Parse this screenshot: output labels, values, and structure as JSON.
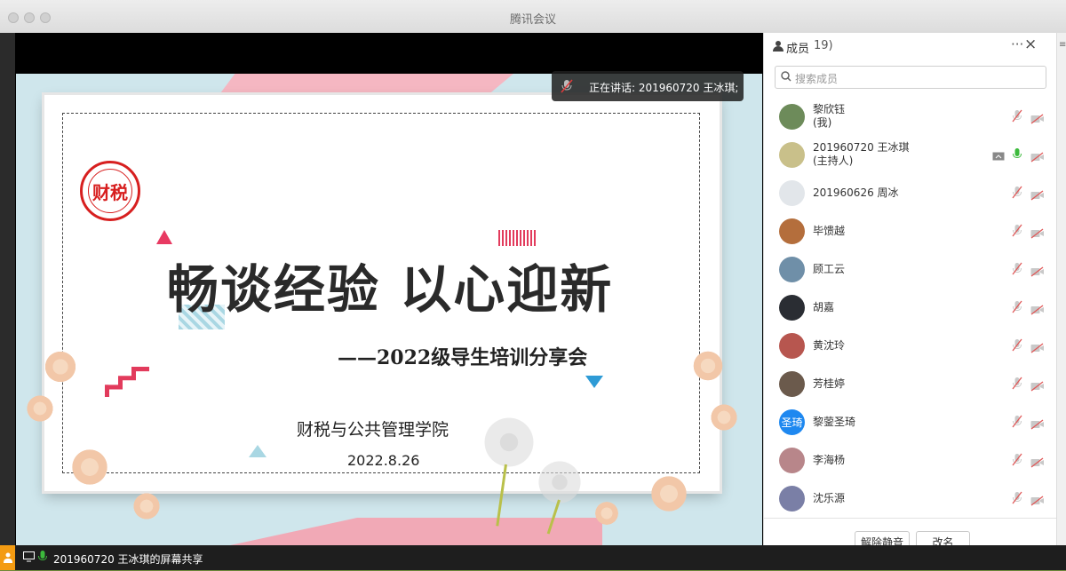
{
  "window": {
    "title": "腾讯会议"
  },
  "speaking": {
    "label": "正在讲话: 201960720 王冰琪;"
  },
  "slide": {
    "logo_text": "财税",
    "title": "畅谈经验 以心迎新",
    "subtitle": "——2022级导生培训分享会",
    "college": "财税与公共管理学院",
    "date": "2022.8.26"
  },
  "bottombar": {
    "share_label": "201960720 王冰琪的屏幕共享"
  },
  "panel": {
    "header_label": "成员",
    "member_count": "19)",
    "search_placeholder": "搜索成员",
    "members": [
      {
        "name": "黎欣钰",
        "role": "(我)",
        "avatar_text": "",
        "avatar_color": "#6d8b5a",
        "mic": "off",
        "share": false
      },
      {
        "name": "201960720 王冰琪",
        "role": "(主持人)",
        "avatar_text": "",
        "avatar_color": "#c9c08a",
        "mic": "on",
        "share": true
      },
      {
        "name": "201960626 周冰",
        "role": "",
        "avatar_text": "",
        "avatar_color": "#e2e6ea",
        "mic": "off",
        "share": false
      },
      {
        "name": "毕馈越",
        "role": "",
        "avatar_text": "",
        "avatar_color": "#b46e3c",
        "mic": "off",
        "share": false
      },
      {
        "name": "顾工云",
        "role": "",
        "avatar_text": "",
        "avatar_color": "#6f8fa8",
        "mic": "off",
        "share": false
      },
      {
        "name": "胡嘉",
        "role": "",
        "avatar_text": "",
        "avatar_color": "#2a2d33",
        "mic": "off",
        "share": false
      },
      {
        "name": "黄沈玲",
        "role": "",
        "avatar_text": "",
        "avatar_color": "#b7564f",
        "mic": "off",
        "share": false
      },
      {
        "name": "芳桂婷",
        "role": "",
        "avatar_text": "",
        "avatar_color": "#6b5a4c",
        "mic": "off",
        "share": false
      },
      {
        "name": "黎蓥圣琦",
        "role": "",
        "avatar_text": "圣琦",
        "avatar_color": "#1e88f0",
        "mic": "off",
        "share": false
      },
      {
        "name": "李海杨",
        "role": "",
        "avatar_text": "",
        "avatar_color": "#b8868a",
        "mic": "off",
        "share": false
      },
      {
        "name": "沈乐源",
        "role": "",
        "avatar_text": "",
        "avatar_color": "#7a7fa6",
        "mic": "off",
        "share": false
      }
    ],
    "unmute_all": "解除静音",
    "rename": "改名"
  },
  "colors": {
    "accent_red": "#e23b5c",
    "mic_on_green": "#3cba3c",
    "brand_blue": "#1e88f0"
  }
}
